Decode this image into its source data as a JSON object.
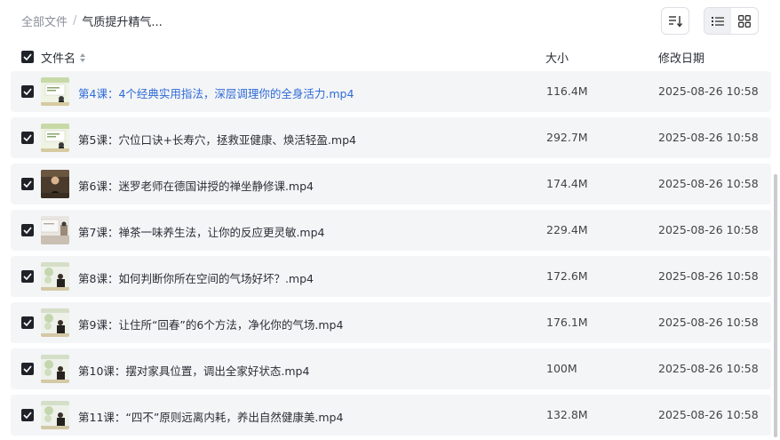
{
  "breadcrumb": {
    "root": "全部文件",
    "separator": "/",
    "current": "气质提升精气..."
  },
  "toolbar": {
    "sort_icon": "sort-icon",
    "list_view_icon": "list-view-icon",
    "grid_view_icon": "grid-view-icon",
    "active_view": "list"
  },
  "table": {
    "columns": {
      "name": "文件名",
      "size": "大小",
      "date": "修改日期"
    },
    "rows": [
      {
        "name": "第4课：4个经典实用指法，深层调理你的全身活力.mp4",
        "size": "116.4M",
        "date": "2025-08-26 10:58",
        "thumb": "light",
        "checked": true,
        "highlight": true
      },
      {
        "name": "第5课：穴位口诀+长寿穴，拯救亚健康、焕活轻盈.mp4",
        "size": "292.7M",
        "date": "2025-08-26 10:58",
        "thumb": "light",
        "checked": true,
        "highlight": false
      },
      {
        "name": "第6课：迷罗老师在德国讲授的禅坐静修课.mp4",
        "size": "174.4M",
        "date": "2025-08-26 10:58",
        "thumb": "dark",
        "checked": true,
        "highlight": false
      },
      {
        "name": "第7课：禅茶一味养生法，让你的反应更灵敏.mp4",
        "size": "229.4M",
        "date": "2025-08-26 10:58",
        "thumb": "room",
        "checked": true,
        "highlight": false
      },
      {
        "name": "第8课：如何判断你所在空间的气场好坏？.mp4",
        "size": "172.6M",
        "date": "2025-08-26 10:58",
        "thumb": "person",
        "checked": true,
        "highlight": false
      },
      {
        "name": "第9课：让住所“回春”的6个方法，净化你的气场.mp4",
        "size": "176.1M",
        "date": "2025-08-26 10:58",
        "thumb": "person",
        "checked": true,
        "highlight": false
      },
      {
        "name": "第10课：摆对家具位置，调出全家好状态.mp4",
        "size": "100M",
        "date": "2025-08-26 10:58",
        "thumb": "person",
        "checked": true,
        "highlight": false
      },
      {
        "name": "第11课：“四不”原则远离内耗，养出自然健康美.mp4",
        "size": "132.8M",
        "date": "2025-08-26 10:58",
        "thumb": "person",
        "checked": true,
        "highlight": false
      }
    ]
  },
  "colors": {
    "link": "#2f6bd7",
    "row_bg": "#f4f5f7",
    "checkbox": "#1f2329"
  }
}
